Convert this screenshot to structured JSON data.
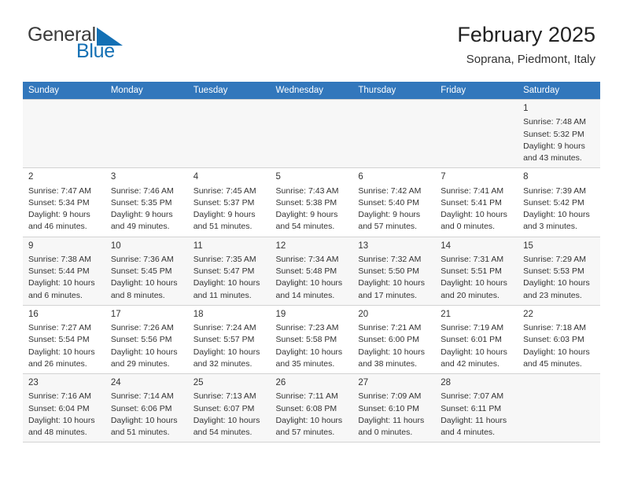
{
  "brand": {
    "word1": "General",
    "word2": "Blue",
    "logo_icon": "triangle-logo-icon",
    "color_blue": "#1470b4",
    "color_dark": "#3b3b3b"
  },
  "header": {
    "title": "February 2025",
    "subtitle": "Soprana, Piedmont, Italy"
  },
  "theme": {
    "header_row_bg": "#3277bc",
    "alt_row_bg": "#f7f7f7",
    "grid_line": "#d3d3d3"
  },
  "weekday_headers": [
    "Sunday",
    "Monday",
    "Tuesday",
    "Wednesday",
    "Thursday",
    "Friday",
    "Saturday"
  ],
  "weeks": [
    [
      {
        "day": "",
        "lines": []
      },
      {
        "day": "",
        "lines": []
      },
      {
        "day": "",
        "lines": []
      },
      {
        "day": "",
        "lines": []
      },
      {
        "day": "",
        "lines": []
      },
      {
        "day": "",
        "lines": []
      },
      {
        "day": "1",
        "lines": [
          "Sunrise: 7:48 AM",
          "Sunset: 5:32 PM",
          "Daylight: 9 hours",
          "and 43 minutes."
        ]
      }
    ],
    [
      {
        "day": "2",
        "lines": [
          "Sunrise: 7:47 AM",
          "Sunset: 5:34 PM",
          "Daylight: 9 hours",
          "and 46 minutes."
        ]
      },
      {
        "day": "3",
        "lines": [
          "Sunrise: 7:46 AM",
          "Sunset: 5:35 PM",
          "Daylight: 9 hours",
          "and 49 minutes."
        ]
      },
      {
        "day": "4",
        "lines": [
          "Sunrise: 7:45 AM",
          "Sunset: 5:37 PM",
          "Daylight: 9 hours",
          "and 51 minutes."
        ]
      },
      {
        "day": "5",
        "lines": [
          "Sunrise: 7:43 AM",
          "Sunset: 5:38 PM",
          "Daylight: 9 hours",
          "and 54 minutes."
        ]
      },
      {
        "day": "6",
        "lines": [
          "Sunrise: 7:42 AM",
          "Sunset: 5:40 PM",
          "Daylight: 9 hours",
          "and 57 minutes."
        ]
      },
      {
        "day": "7",
        "lines": [
          "Sunrise: 7:41 AM",
          "Sunset: 5:41 PM",
          "Daylight: 10 hours",
          "and 0 minutes."
        ]
      },
      {
        "day": "8",
        "lines": [
          "Sunrise: 7:39 AM",
          "Sunset: 5:42 PM",
          "Daylight: 10 hours",
          "and 3 minutes."
        ]
      }
    ],
    [
      {
        "day": "9",
        "lines": [
          "Sunrise: 7:38 AM",
          "Sunset: 5:44 PM",
          "Daylight: 10 hours",
          "and 6 minutes."
        ]
      },
      {
        "day": "10",
        "lines": [
          "Sunrise: 7:36 AM",
          "Sunset: 5:45 PM",
          "Daylight: 10 hours",
          "and 8 minutes."
        ]
      },
      {
        "day": "11",
        "lines": [
          "Sunrise: 7:35 AM",
          "Sunset: 5:47 PM",
          "Daylight: 10 hours",
          "and 11 minutes."
        ]
      },
      {
        "day": "12",
        "lines": [
          "Sunrise: 7:34 AM",
          "Sunset: 5:48 PM",
          "Daylight: 10 hours",
          "and 14 minutes."
        ]
      },
      {
        "day": "13",
        "lines": [
          "Sunrise: 7:32 AM",
          "Sunset: 5:50 PM",
          "Daylight: 10 hours",
          "and 17 minutes."
        ]
      },
      {
        "day": "14",
        "lines": [
          "Sunrise: 7:31 AM",
          "Sunset: 5:51 PM",
          "Daylight: 10 hours",
          "and 20 minutes."
        ]
      },
      {
        "day": "15",
        "lines": [
          "Sunrise: 7:29 AM",
          "Sunset: 5:53 PM",
          "Daylight: 10 hours",
          "and 23 minutes."
        ]
      }
    ],
    [
      {
        "day": "16",
        "lines": [
          "Sunrise: 7:27 AM",
          "Sunset: 5:54 PM",
          "Daylight: 10 hours",
          "and 26 minutes."
        ]
      },
      {
        "day": "17",
        "lines": [
          "Sunrise: 7:26 AM",
          "Sunset: 5:56 PM",
          "Daylight: 10 hours",
          "and 29 minutes."
        ]
      },
      {
        "day": "18",
        "lines": [
          "Sunrise: 7:24 AM",
          "Sunset: 5:57 PM",
          "Daylight: 10 hours",
          "and 32 minutes."
        ]
      },
      {
        "day": "19",
        "lines": [
          "Sunrise: 7:23 AM",
          "Sunset: 5:58 PM",
          "Daylight: 10 hours",
          "and 35 minutes."
        ]
      },
      {
        "day": "20",
        "lines": [
          "Sunrise: 7:21 AM",
          "Sunset: 6:00 PM",
          "Daylight: 10 hours",
          "and 38 minutes."
        ]
      },
      {
        "day": "21",
        "lines": [
          "Sunrise: 7:19 AM",
          "Sunset: 6:01 PM",
          "Daylight: 10 hours",
          "and 42 minutes."
        ]
      },
      {
        "day": "22",
        "lines": [
          "Sunrise: 7:18 AM",
          "Sunset: 6:03 PM",
          "Daylight: 10 hours",
          "and 45 minutes."
        ]
      }
    ],
    [
      {
        "day": "23",
        "lines": [
          "Sunrise: 7:16 AM",
          "Sunset: 6:04 PM",
          "Daylight: 10 hours",
          "and 48 minutes."
        ]
      },
      {
        "day": "24",
        "lines": [
          "Sunrise: 7:14 AM",
          "Sunset: 6:06 PM",
          "Daylight: 10 hours",
          "and 51 minutes."
        ]
      },
      {
        "day": "25",
        "lines": [
          "Sunrise: 7:13 AM",
          "Sunset: 6:07 PM",
          "Daylight: 10 hours",
          "and 54 minutes."
        ]
      },
      {
        "day": "26",
        "lines": [
          "Sunrise: 7:11 AM",
          "Sunset: 6:08 PM",
          "Daylight: 10 hours",
          "and 57 minutes."
        ]
      },
      {
        "day": "27",
        "lines": [
          "Sunrise: 7:09 AM",
          "Sunset: 6:10 PM",
          "Daylight: 11 hours",
          "and 0 minutes."
        ]
      },
      {
        "day": "28",
        "lines": [
          "Sunrise: 7:07 AM",
          "Sunset: 6:11 PM",
          "Daylight: 11 hours",
          "and 4 minutes."
        ]
      },
      {
        "day": "",
        "lines": []
      }
    ]
  ]
}
